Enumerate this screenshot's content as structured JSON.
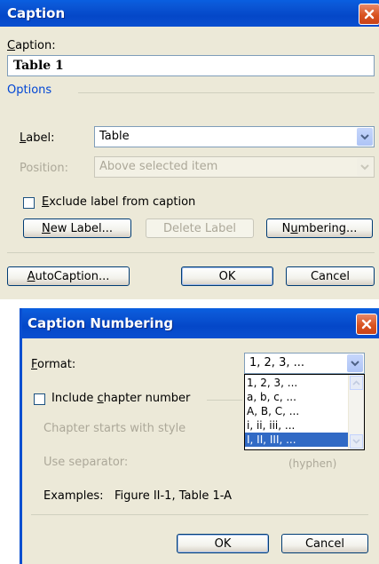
{
  "caption_dialog": {
    "title": "Caption",
    "caption_label": "Caption:",
    "caption_value": "Table 1",
    "options_label": "Options",
    "label_label": "Label:",
    "label_value": "Table",
    "position_label": "Position:",
    "position_value": "Above selected item",
    "exclude_label": "Exclude label from caption",
    "exclude_checked": false,
    "new_label_button": "New Label...",
    "delete_label_button": "Delete Label",
    "numbering_button": "Numbering...",
    "autocaption_button": "AutoCaption...",
    "ok_button": "OK",
    "cancel_button": "Cancel"
  },
  "numbering_dialog": {
    "title": "Caption Numbering",
    "format_label": "Format:",
    "format_value": "1, 2, 3, ...",
    "format_options": [
      "1, 2, 3, ...",
      "a, b, c, ...",
      "A, B, C, ...",
      "i, ii, iii, ...",
      "I, II, III, ..."
    ],
    "highlighted_option_index": 4,
    "include_chapter_label": "Include chapter number",
    "include_chapter_checked": false,
    "chapter_style_label": "Chapter starts with style",
    "separator_label": "Use separator:",
    "separator_value": "(hyphen)",
    "examples_label": "Examples:",
    "examples_value": "Figure II-1, Table 1-A",
    "ok_button": "OK",
    "cancel_button": "Cancel"
  },
  "colors": {
    "titlebar": "#0a4fd0",
    "dialog_bg": "#ece9d8",
    "selection": "#316ac5",
    "close_button": "#d9531f"
  }
}
